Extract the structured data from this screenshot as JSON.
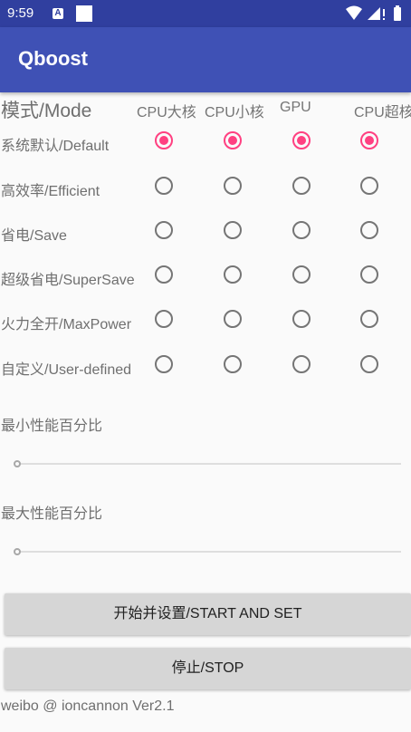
{
  "status_bar": {
    "time": "9:59",
    "notification_icon": "a-icon",
    "indicator_icon": "square-icon",
    "right_icons": [
      "wifi-icon",
      "signal-icon",
      "battery-icon"
    ]
  },
  "app_bar": {
    "title": "Qboost",
    "color": "#3f51b5",
    "status_color": "#303f9f"
  },
  "mode_table": {
    "header": "模式/Mode",
    "columns": [
      "CPU大核",
      "CPU小核",
      "GPU",
      "CPU超核"
    ],
    "rows": [
      {
        "label": "系统默认/Default",
        "checked": [
          true,
          true,
          true,
          true
        ]
      },
      {
        "label": "高效率/Efficient",
        "checked": [
          false,
          false,
          false,
          false
        ]
      },
      {
        "label": "省电/Save",
        "checked": [
          false,
          false,
          false,
          false
        ]
      },
      {
        "label": "超级省电/SuperSave",
        "checked": [
          false,
          false,
          false,
          false
        ]
      },
      {
        "label": "火力全开/MaxPower",
        "checked": [
          false,
          false,
          false,
          false
        ]
      },
      {
        "label": "自定义/User-defined",
        "checked": [
          false,
          false,
          false,
          false
        ]
      }
    ],
    "accent_color": "#ff4081"
  },
  "min_perf": {
    "label": "最小性能百分比",
    "value_percent": 0
  },
  "max_perf": {
    "label": "最大性能百分比",
    "value_percent": 0
  },
  "buttons": {
    "start": "开始并设置/START AND SET",
    "stop": "停止/STOP"
  },
  "footer": "weibo @ ioncannon Ver2.1"
}
